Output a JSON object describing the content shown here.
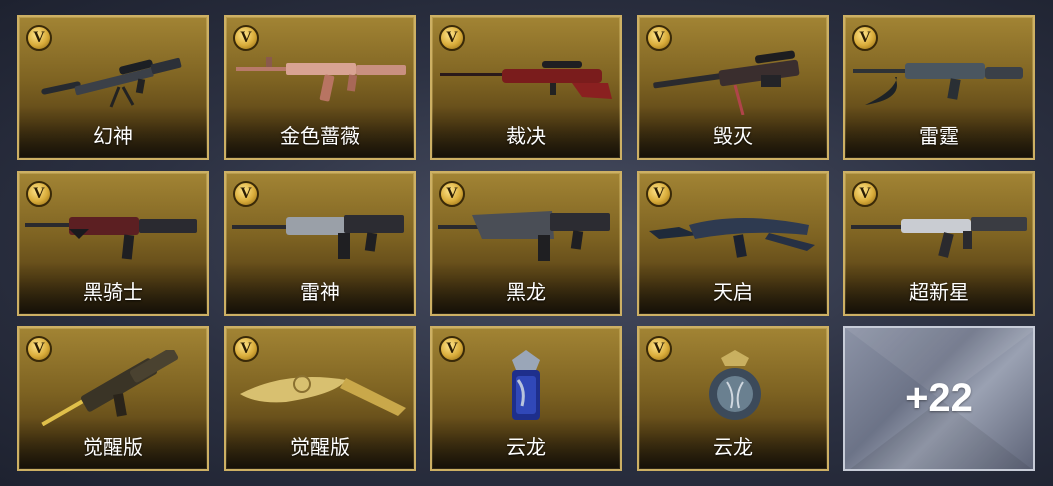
{
  "badge_letter": "V",
  "items": [
    {
      "name": "幻神",
      "icon": "sniper-rifle-icon"
    },
    {
      "name": "金色蔷薇",
      "icon": "assault-rifle-rose-icon"
    },
    {
      "name": "裁决",
      "icon": "sniper-rifle-red-icon"
    },
    {
      "name": "毁灭",
      "icon": "heavy-sniper-icon"
    },
    {
      "name": "雷霆",
      "icon": "assault-rifle-blade-icon"
    },
    {
      "name": "黑骑士",
      "icon": "m4-rifle-red-icon"
    },
    {
      "name": "雷神",
      "icon": "m4-rifle-silver-icon"
    },
    {
      "name": "黑龙",
      "icon": "m4-rifle-dragon-icon"
    },
    {
      "name": "天启",
      "icon": "blade-rifle-icon"
    },
    {
      "name": "超新星",
      "icon": "ak-rifle-icon"
    },
    {
      "name": "觉醒版",
      "icon": "golden-rifle-icon"
    },
    {
      "name": "觉醒版",
      "icon": "golden-kukri-icon"
    },
    {
      "name": "云龙",
      "icon": "dragon-grenade-icon"
    },
    {
      "name": "云龙",
      "icon": "dragon-shield-grenade-icon"
    }
  ],
  "more_label": "+22",
  "colors": {
    "card_gold": "#8a6d28",
    "card_border": "#cdb064",
    "more_bg": "#7a8195"
  }
}
